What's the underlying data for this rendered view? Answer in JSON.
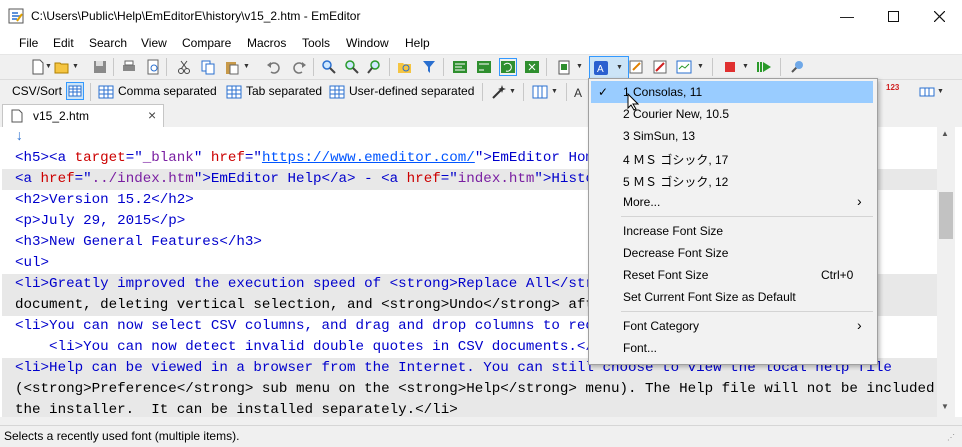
{
  "window": {
    "title": "C:\\Users\\Public\\Help\\EmEditorE\\history\\v15_2.htm - EmEditor"
  },
  "menubar": [
    "File",
    "Edit",
    "Search",
    "View",
    "Compare",
    "Macros",
    "Tools",
    "Window",
    "Help"
  ],
  "csv_toolbar": {
    "label": "CSV/Sort",
    "comma": "Comma separated",
    "tab": "Tab separated",
    "user_defined": "User-defined separated",
    "counter": "123"
  },
  "tab": {
    "name": "v15_2.htm",
    "close": "×"
  },
  "editor": {
    "return_mark": "↓",
    "l_h5": [
      "<h5><a ",
      "target",
      "=\"",
      "_blank",
      "\" ",
      "href",
      "=\"",
      "https://www.emeditor.com/",
      "\">EmEditor Home</"
    ],
    "l_a": [
      "<a ",
      "href",
      "=\"",
      "../index.htm",
      "\">EmEditor Help</a> - <a ",
      "href",
      "=\"",
      "index.htm",
      "\">History</"
    ],
    "l_h2": "<h2>Version 15.2</h2>",
    "l_p": "<p>July 29, 2015</p>",
    "l_h3": "<h3>New General Features</h3>",
    "l_ul": "<ul>",
    "l_li1": [
      "<li>Greatly improved the execution speed of <strong>Replace All</strong>",
      ""
    ],
    "l_doc": [
      "document, deleting vertical selection, and <strong>Undo</strong> after <"
    ],
    "l_li2": "<li>You can now select CSV columns, and drag and drop columns to reorder",
    "l_li3": "    <li>You can now detect invalid double quotes in CSV documents.</li>",
    "l_li4": "<li>Help can be viewed in a browser from the Internet. You can still choose to view the local help file",
    "l_pref": "(<strong>Preference</strong> sub menu on the <strong>Help</strong> menu). The Help file will not be included in",
    "l_inst": "the installer.  It can be installed separately.</li>"
  },
  "status": "Selects a recently used font (multiple items).",
  "font_menu": {
    "check": "✓",
    "recent": [
      "1 Consolas, 11",
      "2 Courier New, 10.5",
      "3 SimSun, 13",
      "4 ＭＳ ゴシック, 17",
      "5 ＭＳ ゴシック, 12"
    ],
    "more": "More...",
    "increase": "Increase Font Size",
    "decrease": "Decrease Font Size",
    "reset": "Reset Font Size",
    "reset_shortcut": "Ctrl+0",
    "set_default": "Set Current Font Size as Default",
    "category": "Font Category",
    "font": "Font...",
    "arrow": "›"
  },
  "colors": {
    "tag": "#0000cc",
    "attr": "#cc0000",
    "value": "#7a1fa2",
    "link": "#0055ff",
    "highlight": "#99ccff"
  }
}
